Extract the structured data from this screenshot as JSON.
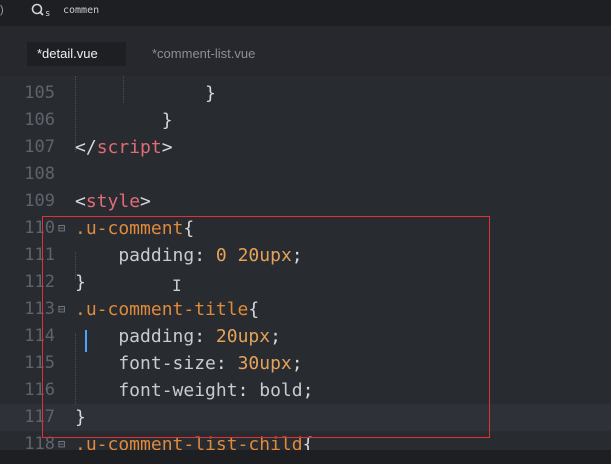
{
  "topbar": {
    "left_glyph": ")",
    "search_prefix": "s",
    "search_text": "commen"
  },
  "tabs": [
    {
      "label": "*detail.vue",
      "active": true
    },
    {
      "label": "*comment-list.vue",
      "active": false
    }
  ],
  "lines": [
    {
      "number": "105",
      "tokens": [
        {
          "t": "            }",
          "c": "punct"
        }
      ]
    },
    {
      "number": "106",
      "tokens": [
        {
          "t": "        }",
          "c": "punct"
        }
      ]
    },
    {
      "number": "107",
      "tokens": [
        {
          "t": "</",
          "c": "punct"
        },
        {
          "t": "script",
          "c": "tag"
        },
        {
          "t": ">",
          "c": "punct"
        }
      ]
    },
    {
      "number": "108",
      "tokens": []
    },
    {
      "number": "109",
      "tokens": [
        {
          "t": "<",
          "c": "punct"
        },
        {
          "t": "style",
          "c": "tag"
        },
        {
          "t": ">",
          "c": "punct"
        }
      ]
    },
    {
      "number": "110",
      "fold": "⊟",
      "tokens": [
        {
          "t": ".u-comment",
          "c": "sel"
        },
        {
          "t": "{",
          "c": "punct"
        }
      ]
    },
    {
      "number": "111",
      "tokens": [
        {
          "t": "    padding",
          "c": "prop"
        },
        {
          "t": ": ",
          "c": "punct"
        },
        {
          "t": "0",
          "c": "num"
        },
        {
          "t": " ",
          "c": "punct"
        },
        {
          "t": "20upx",
          "c": "num"
        },
        {
          "t": ";",
          "c": "punct"
        }
      ]
    },
    {
      "number": "112",
      "tokens": [
        {
          "t": "}",
          "c": "punct"
        }
      ]
    },
    {
      "number": "113",
      "fold": "⊟",
      "tokens": [
        {
          "t": ".u-comment-title",
          "c": "sel"
        },
        {
          "t": "{",
          "c": "punct"
        }
      ]
    },
    {
      "number": "114",
      "tokens": [
        {
          "t": "    padding",
          "c": "prop"
        },
        {
          "t": ": ",
          "c": "punct"
        },
        {
          "t": "20upx",
          "c": "num"
        },
        {
          "t": ";",
          "c": "punct"
        }
      ]
    },
    {
      "number": "115",
      "tokens": [
        {
          "t": "    font-size",
          "c": "prop"
        },
        {
          "t": ": ",
          "c": "punct"
        },
        {
          "t": "30upx",
          "c": "num"
        },
        {
          "t": ";",
          "c": "punct"
        }
      ]
    },
    {
      "number": "116",
      "tokens": [
        {
          "t": "    font-weight",
          "c": "prop"
        },
        {
          "t": ": ",
          "c": "punct"
        },
        {
          "t": "bold",
          "c": "val"
        },
        {
          "t": ";",
          "c": "punct"
        }
      ]
    },
    {
      "number": "117",
      "current": true,
      "tokens": [
        {
          "t": "}",
          "c": "punct"
        }
      ]
    },
    {
      "number": "118",
      "fold": "⊟",
      "tokens": [
        {
          "t": ".u-comment-list-child",
          "c": "sel"
        },
        {
          "t": "{",
          "c": "punct"
        }
      ]
    }
  ]
}
